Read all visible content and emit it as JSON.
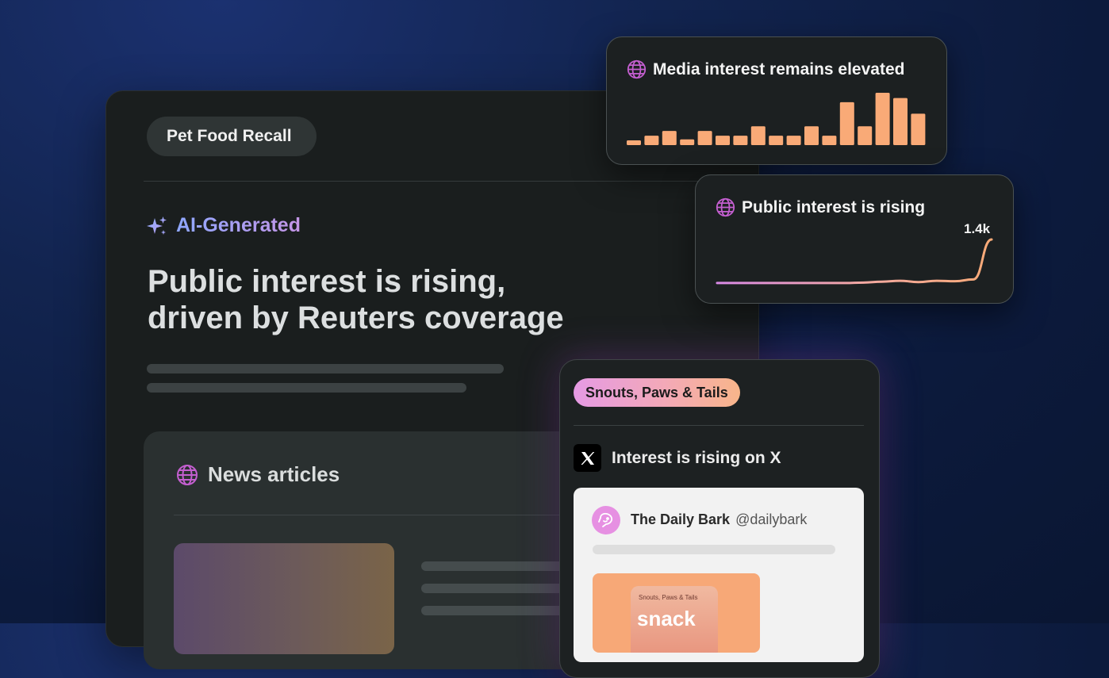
{
  "topic_chip": "Pet Food Recall",
  "ai_label": "AI-Generated",
  "headline": {
    "line1": "Public interest is rising,",
    "line2": "driven by Reuters coverage"
  },
  "news_section": {
    "title": "News articles"
  },
  "media_card": {
    "title": "Media interest remains elevated",
    "bars": [
      0.09,
      0.18,
      0.27,
      0.11,
      0.27,
      0.18,
      0.18,
      0.36,
      0.18,
      0.18,
      0.36,
      0.18,
      0.82,
      0.36,
      1.0,
      0.9,
      0.6
    ]
  },
  "public_card": {
    "title": "Public interest is rising",
    "peak_label": "1.4k",
    "line": [
      0.02,
      0.02,
      0.02,
      0.02,
      0.02,
      0.02,
      0.02,
      0.02,
      0.03,
      0.05,
      0.07,
      0.04,
      0.07,
      0.06,
      0.1,
      1.0
    ]
  },
  "social_card": {
    "source": "Snouts, Paws & Tails",
    "platform_label": "Interest is rising on X",
    "tweet": {
      "name": "The Daily Bark",
      "handle": "@dailybark",
      "product_brand": "Snouts, Paws & Tails",
      "product_word": "snack"
    }
  },
  "icons": {
    "globe": "globe-icon",
    "sparkle": "sparkle-icon",
    "x_logo": "x-logo-icon",
    "dog": "dog-icon"
  },
  "colors": {
    "accent_orange": "#f9aa77",
    "globe_purple": "#c45fd0",
    "ai_gradient_start": "#8fa8ff",
    "ai_gradient_end": "#c495e6"
  }
}
